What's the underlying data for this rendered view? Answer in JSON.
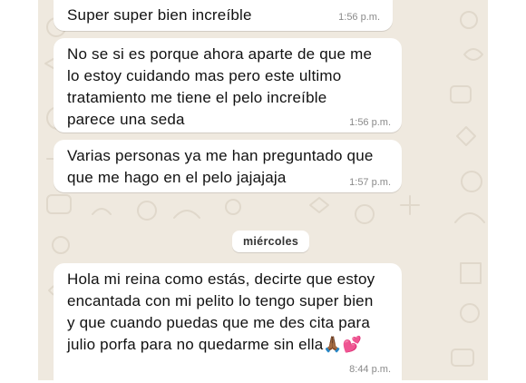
{
  "messages": [
    {
      "text": "Super super bien increíble",
      "time": "1:56 p.m."
    },
    {
      "text": "No se si es porque ahora aparte de que me\nlo estoy cuidando mas pero este ultimo\ntratamiento me tiene el pelo increíble\nparece una seda",
      "time": "1:56 p.m."
    },
    {
      "text": "Varias personas ya me han preguntado que\nque me hago en el pelo jajajaja",
      "time": "1:57 p.m."
    },
    {
      "text": "Hola mi reina como estás, decirte que estoy\nencantada con mi pelito lo tengo super bien\ny que cuando puedas que me des cita para\njulio porfa para no quedarme sin ella🙏🏾💕",
      "time": "8:44 p.m."
    }
  ],
  "day_separator": "miércoles",
  "colors": {
    "chat_background": "#efe9df",
    "bubble": "#ffffff",
    "timestamp": "#8a8a8a"
  }
}
